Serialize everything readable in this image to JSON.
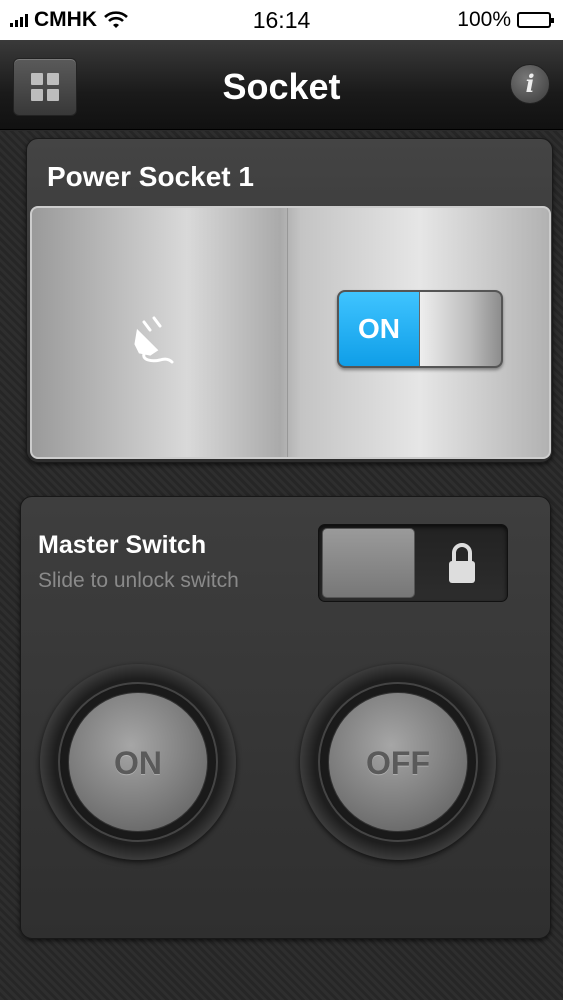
{
  "status_bar": {
    "carrier": "CMHK",
    "time": "16:14",
    "battery": "100%"
  },
  "nav": {
    "title": "Socket",
    "info_label": "i"
  },
  "socket_panel": {
    "title": "Power Socket 1",
    "toggle_state_label": "ON"
  },
  "master_panel": {
    "title": "Master Switch",
    "subtitle": "Slide to unlock switch",
    "on_button_label": "ON",
    "off_button_label": "OFF"
  },
  "colors": {
    "toggle_on": "#1aa9ef",
    "background": "#2b2b2b"
  },
  "icons": [
    "signal-icon",
    "wifi-icon",
    "battery-icon",
    "grid-menu-icon",
    "info-icon",
    "plug-icon",
    "lock-icon"
  ]
}
